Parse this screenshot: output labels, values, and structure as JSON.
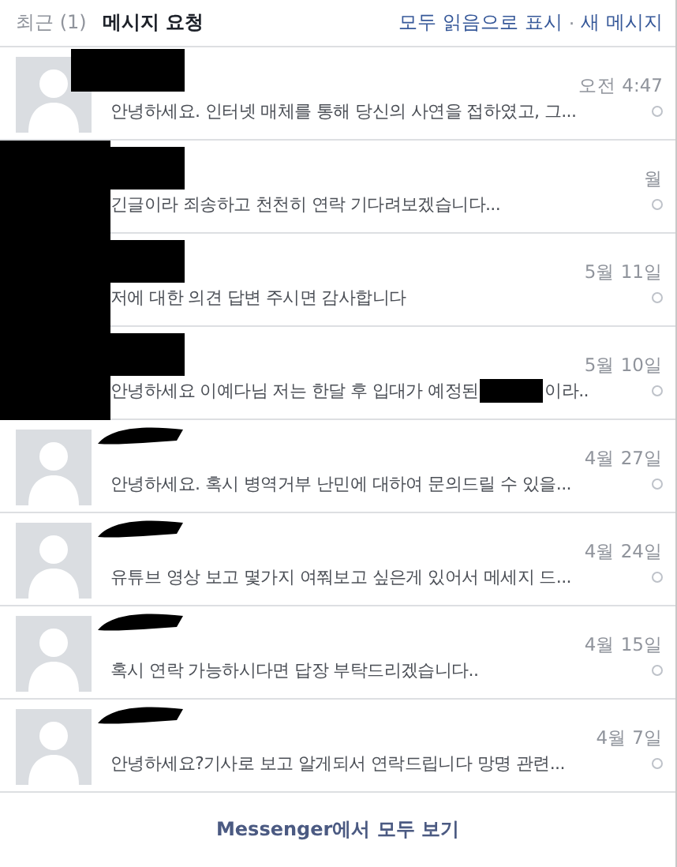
{
  "header": {
    "tabs": [
      {
        "label": "최근 (1)",
        "selected": false
      },
      {
        "label": "메시지 요청",
        "selected": true
      }
    ],
    "links": [
      "모두 읽음으로 표시",
      "새 메시지"
    ],
    "separator": "·"
  },
  "messages": [
    {
      "kind": "box",
      "time": "오전 4:47",
      "message": "안녕하세요. 인터넷 매체를 통해 당신의 사연을 접하였고, 그..."
    },
    {
      "kind": "block",
      "time": "월",
      "message": "긴글이라 죄송하고 천천히 연락 기다려보겠습니다..."
    },
    {
      "kind": "block",
      "time": "5월 11일",
      "message": "저에 대한 의견 답변 주시면 감사합니다"
    },
    {
      "kind": "block",
      "time": "5월 10일",
      "message": "안녕하세요 이예다님 저는 한달 후 입대가 예정된",
      "message_end": "이라.."
    },
    {
      "kind": "scribble",
      "time": "4월 27일",
      "message": "안녕하세요. 혹시 병역거부 난민에 대하여 문의드릴 수 있을..."
    },
    {
      "kind": "scribble",
      "time": "4월 24일",
      "message": "유튜브 영상 보고 몇가지 여쭤보고 싶은게 있어서 메세지 드..."
    },
    {
      "kind": "scribble",
      "time": "4월 15일",
      "message": "혹시 연락 가능하시다면 답장 부탁드리겠습니다.."
    },
    {
      "kind": "scribble",
      "time": "4월 7일",
      "message": "안녕하세요?기사로 보고 알게되서 연락드립니다 망명 관련..."
    }
  ],
  "footer": {
    "link": "Messenger에서 모두 보기"
  }
}
